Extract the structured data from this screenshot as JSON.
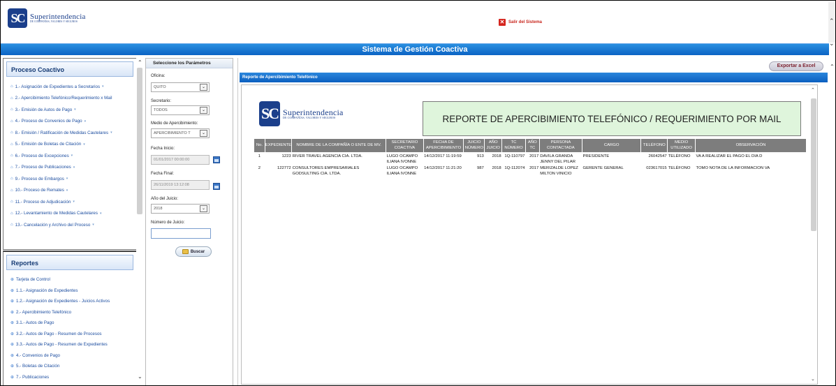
{
  "header": {
    "logo_mark": "SC",
    "logo_name": "Superintendencia",
    "logo_subtitle": "DE COMPAÑÍAS, VALORES Y SEGUROS",
    "exit_label": "Salir del Sistema"
  },
  "banner": {
    "title": "Sistema de Gestión Coactiva"
  },
  "sidebar": {
    "proceso_title": "Proceso Coactivo",
    "proceso_items": [
      {
        "label": "1.- Asignación de Expedientes a Secretarios",
        "has_submenu": true
      },
      {
        "label": "2.- Apercibimiento Telefónico/Requerimiento x Mail",
        "has_submenu": false
      },
      {
        "label": "3.- Emisión de Autos de Pago",
        "has_submenu": true
      },
      {
        "label": "4.- Proceso de Convenios de Pago",
        "has_submenu": true
      },
      {
        "label": "8.- Emisión / Ratificación de Medidas Cautelares",
        "has_submenu": true
      },
      {
        "label": "5.- Emisión de Boletas de Citación",
        "has_submenu": true
      },
      {
        "label": "6.- Proceso de Excepciones",
        "has_submenu": true
      },
      {
        "label": "7.- Proceso de Publicaciones",
        "has_submenu": true
      },
      {
        "label": "9.- Proceso de Embargos",
        "has_submenu": true
      },
      {
        "label": "10.- Proceso de Remates",
        "has_submenu": true
      },
      {
        "label": "11.- Proceso de Adjudicación",
        "has_submenu": true
      },
      {
        "label": "12.- Levantamiento de Medidas Cautelares",
        "has_submenu": true
      },
      {
        "label": "13.- Cancelación y Archivo del Proceso",
        "has_submenu": true
      }
    ],
    "reportes_title": "Reportes",
    "reportes_items": [
      "Tarjeta de Control",
      "1.1.- Asignación de Expedientes",
      "1.2.- Asignación de Expedientes - Juicios Activos",
      "2.- Apercibimiento Telefónico",
      "3.1.- Autos de Pago",
      "3.2.- Autos de Pago - Resumen de Procesos",
      "3.3.- Autos de Pago - Resumen de Expedientes",
      "4.- Convenios de Pago",
      "5.- Boletas de Citación",
      "7.- Publicaciones"
    ]
  },
  "params": {
    "title": "Seleccione los Parámetros",
    "oficina_label": "Oficina:",
    "oficina_value": "QUITO",
    "secretario_label": "Secretario:",
    "secretario_value": "TODOS",
    "medio_label": "Medio de Apercibimiento:",
    "medio_value": "APERCIBIMIENTO T",
    "fecha_inicio_label": "Fecha Inicio:",
    "fecha_inicio_value": "01/01/2017 00:00:00",
    "fecha_final_label": "Fecha Final:",
    "fecha_final_value": "26/11/2019 13:12:08",
    "anio_label": "Año del Juicio:",
    "anio_value": "2018",
    "numero_label": "Número de Juicio:",
    "numero_value": "",
    "buscar_label": "Buscar"
  },
  "report": {
    "export_label": "Exportar a Excel",
    "bar_title": "Reporte de Apercibimiento Telefónico",
    "title": "REPORTE DE APERCIBIMIENTO TELEFÓNICO / REQUERIMIENTO POR MAIL",
    "columns": [
      "No.",
      "EXPEDIENTE",
      "NOMBRE DE LA COMPAÑÍA O ENTE DE MV.",
      "SECRETARIO COACTIVA",
      "FECHA DE APERCIBIMIENTO",
      "JUICIO NÚMERO",
      "AÑO JUICIO",
      "TC NÚMERO",
      "AÑO TC",
      "PERSONA CONTACTADA",
      "CARGO",
      "TELÉFONO",
      "MEDIO UTILIZADO",
      "OBSERVACIÓN"
    ],
    "rows": [
      [
        "1",
        "1223",
        "RIVER TRAVEL AGENCIA CIA. LTDA.",
        "LUGO OCAMPO ILIANA IVONNE",
        "14/12/2017 11:19:59",
        "913",
        "2018",
        "1Q-110797",
        "2017",
        "DAVILA GRANDA JENNY DEL PILAR",
        "PRESIDENTE",
        "26042547",
        "TELÉFONO",
        "VA A REALIZAR EL PAGO EL DIA D"
      ],
      [
        "2",
        "122772",
        "CONSULTORES EMPRESARIALES GODSULTING CIA. LTDA.",
        "LUGO OCAMPO ILIANA IVONNE",
        "14/12/2017 11:21:20",
        "987",
        "2018",
        "1Q-112074",
        "2017",
        "MERIZALDE LOPEZ MILTON VINICIO",
        "GERENTE GENERAL",
        "023617015",
        "TELÉFONO",
        "TOMO NOTA DE LA INFORMACION VA"
      ]
    ]
  }
}
